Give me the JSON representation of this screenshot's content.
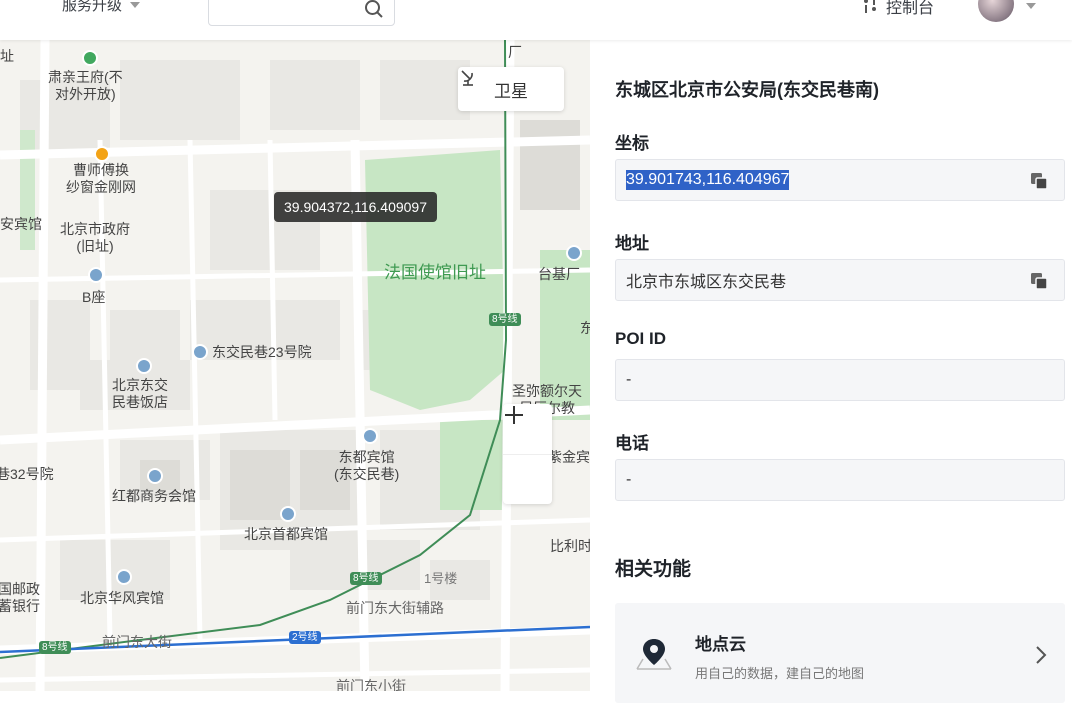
{
  "topbar": {
    "service_upgrade": "服务升级",
    "search_value": "",
    "console": "控制台"
  },
  "map": {
    "satellite_label": "卫星",
    "tooltip_coords": "39.904372,116.409097",
    "labels": {
      "suqinwang": "肃亲王府(不\n对外开放)",
      "caoshi": "曹师傅换\n纱窗金刚网",
      "bjgov": "北京市政府\n(旧址)",
      "bzuo": "B座",
      "anbinguan": "端安宾馆",
      "fagu": "法国使馆旧址",
      "taiji": "台基厂",
      "line8a": "8号线",
      "djmx23": "东交民巷23号院",
      "bjdjmx": "北京东交\n民巷饭店",
      "simier": "圣弥额尔天\n尼厄尔教",
      "dongdu": "东都宾馆\n(东交民巷)",
      "hao32": "巷32号院",
      "hongdu": "红都商务会馆",
      "jinjin": "紫金宾",
      "shoudu": "北京首都宾馆",
      "bilishi": "比利时",
      "guoyouzheng": "国邮政\n蓄银行",
      "huafeng": "北京华风宾馆",
      "line8b": "8号线",
      "lou1": "1号楼",
      "qmdjfl": "前门东大街辅路",
      "qmdj": "前门东大街",
      "line8c": "8号线",
      "line2": "2号线",
      "qmdxj": "前门东小街",
      "chang": "厂",
      "zhi": "址",
      "dong": "东"
    }
  },
  "panel": {
    "title": "东城区北京市公安局(东交民巷南)",
    "coord_label": "坐标",
    "coord_value": "39.901743,116.404967",
    "address_label": "地址",
    "address_value": "北京市东城区东交民巷",
    "poi_label": "POI ID",
    "poi_value": "-",
    "phone_label": "电话",
    "phone_value": "-",
    "related_title": "相关功能",
    "feature_name": "地点云",
    "feature_desc": "用自己的数据，建自己的地图"
  },
  "colors": {
    "accent": "#2f62c7",
    "metro_line8": "#3f8d57",
    "metro_line2": "#2c6fd1",
    "park_green": "#c7e6c4"
  }
}
